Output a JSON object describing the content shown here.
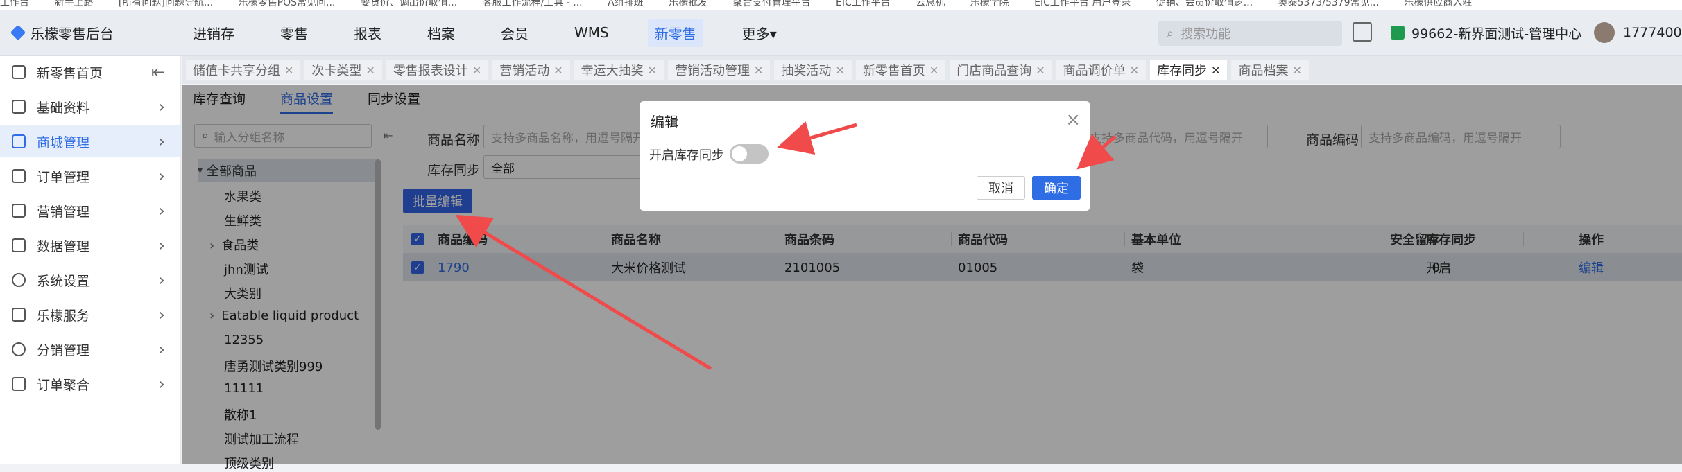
{
  "bookmarks": [
    "工作台",
    "新手上路",
    "[所有问题]问题导航...",
    "乐檬零售POS常见问...",
    "要货价、调出价取值...",
    "客服工作流程/工具 - ...",
    "A组排班",
    "乐檬批发",
    "聚合支付管理平台",
    "EIC工作平台",
    "云总机",
    "乐檬学院",
    "EIC工作平台 用户登录",
    "促销、会员价取值逻...",
    "奥泰5373/5379常见...",
    "乐檬供应商入驻"
  ],
  "header": {
    "app_title": "乐檬零售后台",
    "menu": [
      "进销存",
      "零售",
      "报表",
      "档案",
      "会员",
      "WMS",
      "新零售",
      "更多▾"
    ],
    "active_menu": "新零售",
    "search_placeholder": "搜索功能",
    "store": "99662-新界面测试-管理中心",
    "user": "177740052"
  },
  "sidebar": {
    "collapse_icon": "⇤",
    "items": [
      {
        "label": "新零售首页",
        "icon": "home-icon"
      },
      {
        "label": "基础资料",
        "icon": "grid-icon"
      },
      {
        "label": "商城管理",
        "icon": "store-icon"
      },
      {
        "label": "订单管理",
        "icon": "order-icon"
      },
      {
        "label": "营销管理",
        "icon": "marketing-icon"
      },
      {
        "label": "数据管理",
        "icon": "chart-icon"
      },
      {
        "label": "系统设置",
        "icon": "settings-icon"
      },
      {
        "label": "乐檬服务",
        "icon": "service-icon"
      },
      {
        "label": "分销管理",
        "icon": "distribution-icon"
      },
      {
        "label": "订单聚合",
        "icon": "aggregate-icon"
      }
    ]
  },
  "tabs": [
    "储值卡共享分组",
    "次卡类型",
    "零售报表设计",
    "营销活动",
    "幸运大抽奖",
    "营销活动管理",
    "抽奖活动",
    "新零售首页",
    "门店商品查询",
    "商品调价单",
    "库存同步",
    "商品档案"
  ],
  "active_tab": "库存同步",
  "subtabs": [
    "库存查询",
    "商品设置",
    "同步设置"
  ],
  "active_subtab": "商品设置",
  "tree": {
    "search_placeholder": "输入分组名称",
    "root": "全部商品",
    "nodes": [
      "水果类",
      "生鲜类",
      "食品类",
      "jhn测试",
      "大类别",
      "Eatable liquid product",
      "12355",
      "唐勇测试类别999",
      "11111",
      "散称1",
      "测试加工流程",
      "顶级类别"
    ]
  },
  "filters": {
    "name_label": "商品名称",
    "name_placeholder": "支持多商品名称，用逗号隔开",
    "code_placeholder": "支持多商品代码，用逗号隔开",
    "barcode_label": "商品编码",
    "barcode_placeholder": "支持多商品编码，用逗号隔开",
    "sync_label": "库存同步",
    "sync_value": "全部"
  },
  "batch_edit": "批量编辑",
  "table": {
    "headers": [
      "商品编码",
      "商品名称",
      "商品条码",
      "商品代码",
      "基本单位",
      "安全留存",
      "库存同步",
      "操作"
    ],
    "row": {
      "code": "1790",
      "name": "大米价格测试",
      "barcode": "2101005",
      "item_code": "01005",
      "unit": "袋",
      "reserve": "0",
      "sync": "开启",
      "action": "编辑"
    }
  },
  "modal": {
    "title": "编辑",
    "toggle_label": "开启库存同步",
    "toggle_on": false,
    "cancel": "取消",
    "confirm": "确定"
  },
  "colors": {
    "accent": "#2f6de5",
    "annotation": "#f04a4a"
  }
}
